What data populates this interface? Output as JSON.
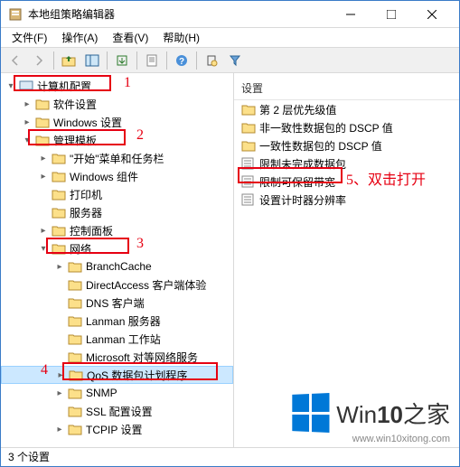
{
  "window": {
    "title": "本地组策略编辑器"
  },
  "menu": {
    "file": "文件(F)",
    "action": "操作(A)",
    "view": "查看(V)",
    "help": "帮助(H)"
  },
  "tree": {
    "root": "计算机配置",
    "lvl1a": "软件设置",
    "lvl1b": "Windows 设置",
    "lvl1c": "管理模板",
    "lvl2a": "\"开始\"菜单和任务栏",
    "lvl2b": "Windows 组件",
    "lvl2c": "打印机",
    "lvl2d": "服务器",
    "lvl2e": "控制面板",
    "lvl2f": "网络",
    "lvl3a": "BranchCache",
    "lvl3b": "DirectAccess 客户端体验",
    "lvl3c": "DNS 客户端",
    "lvl3d": "Lanman 服务器",
    "lvl3e": "Lanman 工作站",
    "lvl3f": "Microsoft 对等网络服务",
    "lvl3g": "QoS 数据包计划程序",
    "lvl3h": "SNMP",
    "lvl3i": "SSL 配置设置",
    "lvl3j": "TCPIP 设置"
  },
  "list": {
    "header": "设置",
    "i1": "第 2 层优先级值",
    "i2": "非一致性数据包的 DSCP 值",
    "i3": "一致性数据包的 DSCP 值",
    "i4": "限制未完成数据包",
    "i5": "限制可保留带宽",
    "i6": "设置计时器分辨率"
  },
  "status": "3 个设置",
  "anno": {
    "n1": "1",
    "n2": "2",
    "n3": "3",
    "n4": "4",
    "n5": "5、双击打开"
  },
  "watermark": {
    "brand1": "Win",
    "brand2": "10",
    "brand3": "之家",
    "url": "www.win10xitong.com"
  }
}
